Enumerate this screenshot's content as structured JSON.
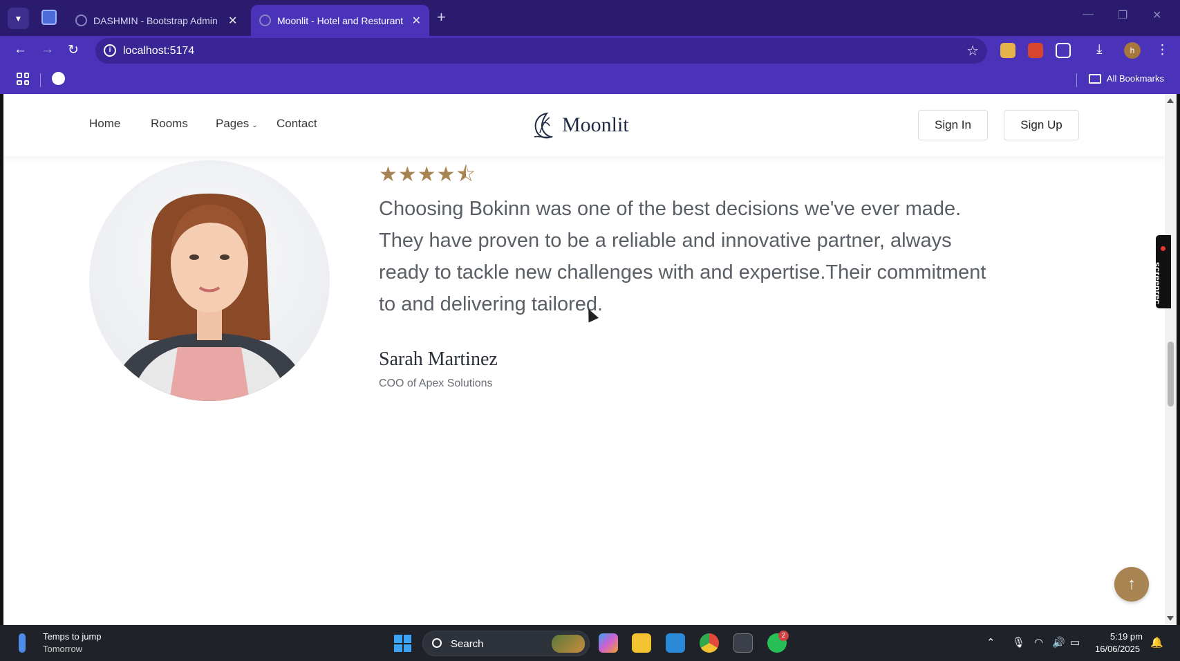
{
  "browser": {
    "tabs": [
      {
        "title": "DASHMIN - Bootstrap Admin T",
        "active": false
      },
      {
        "title": "Moonlit - Hotel and Resturant |",
        "active": true
      }
    ],
    "url": "localhost:5174",
    "profile_initial": "h",
    "bookmarks_label": "All Bookmarks"
  },
  "site": {
    "nav": [
      {
        "label": "Home"
      },
      {
        "label": "Rooms"
      },
      {
        "label": "Pages"
      },
      {
        "label": "Contact"
      }
    ],
    "brand": "Moonlit",
    "sign_in": "Sign In",
    "sign_up": "Sign Up"
  },
  "testimonial": {
    "rating": 4.5,
    "stars_text": "★★★★⯪",
    "quote": "Choosing Bokinn was one of the best decisions we've ever made. They have proven to be a reliable and innovative partner, always ready to tackle new challenges with and expertise.Their commitment to and delivering tailored.",
    "author": "Sarah Martinez",
    "role": "COO of Apex Solutions"
  },
  "screenrec_label": "screenrec",
  "taskbar": {
    "weather_title": "Temps to jump",
    "weather_sub": "Tomorrow",
    "search_label": "Search",
    "whatsapp_badge": "2",
    "time": "5:19 pm",
    "date": "16/06/2025"
  },
  "colors": {
    "browser_frame": "#4a33b8",
    "accent_gold": "#a88452",
    "brand_navy": "#1f2a44"
  }
}
